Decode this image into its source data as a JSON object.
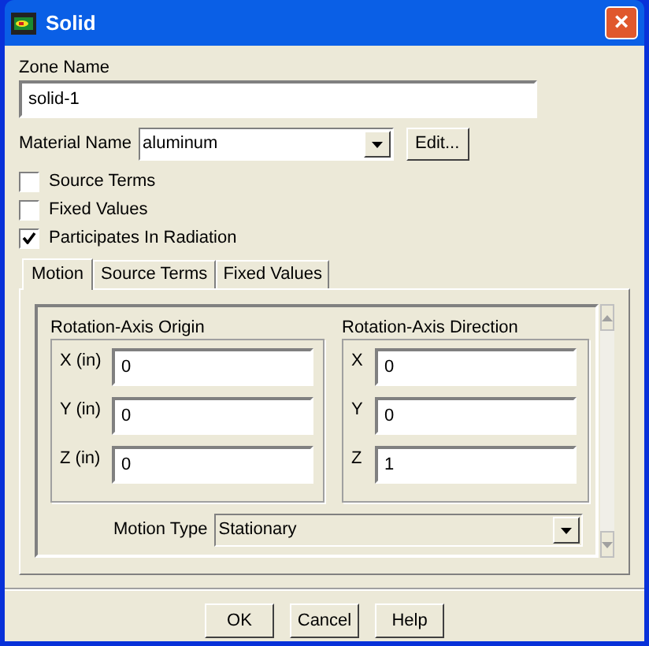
{
  "window": {
    "title": "Solid",
    "close": "×"
  },
  "zone_name": {
    "label": "Zone Name",
    "value": "solid-1"
  },
  "material": {
    "label": "Material Name",
    "value": "aluminum",
    "button": "Edit..."
  },
  "options": [
    {
      "label": "Source Terms",
      "checked": false
    },
    {
      "label": "Fixed Values",
      "checked": false
    },
    {
      "label": "Participates In Radiation",
      "checked": true
    }
  ],
  "tabs": [
    {
      "label": "Motion",
      "selected": true
    },
    {
      "label": "Source Terms",
      "selected": false
    },
    {
      "label": "Fixed Values",
      "selected": false
    }
  ],
  "groups": [
    {
      "title": "Rotation-Axis Origin",
      "fields": [
        {
          "label": "X (in)",
          "value": "0"
        },
        {
          "label": "Y (in)",
          "value": "0"
        },
        {
          "label": "Z (in)",
          "value": "0"
        }
      ]
    },
    {
      "title": "Rotation-Axis Direction",
      "fields": [
        {
          "label": "X",
          "value": "0"
        },
        {
          "label": "Y",
          "value": "0"
        },
        {
          "label": "Z",
          "value": "1"
        }
      ]
    }
  ],
  "motion_type": {
    "label": "Motion Type",
    "value": "Stationary"
  },
  "buttons": [
    "OK",
    "Cancel",
    "Help"
  ]
}
